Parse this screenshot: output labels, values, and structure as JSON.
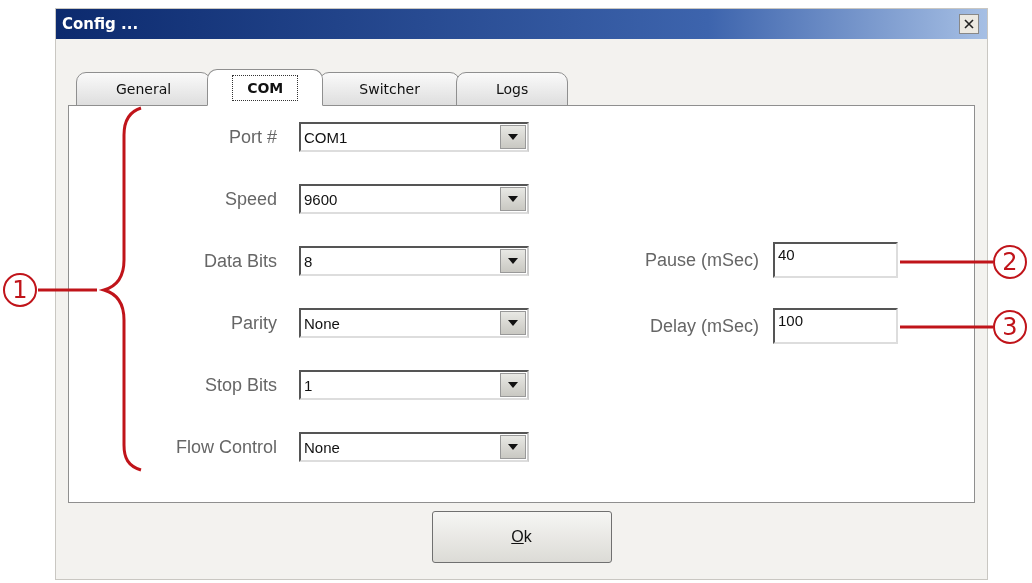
{
  "window": {
    "title": "Config ..."
  },
  "tabs": [
    {
      "label": "General",
      "selected": false
    },
    {
      "label": "COM",
      "selected": true
    },
    {
      "label": "Switcher",
      "selected": false
    },
    {
      "label": "Logs",
      "selected": false
    }
  ],
  "com_settings": [
    {
      "label": "Port #",
      "value": "COM1"
    },
    {
      "label": "Speed",
      "value": "9600"
    },
    {
      "label": "Data Bits",
      "value": "8"
    },
    {
      "label": "Parity",
      "value": "None"
    },
    {
      "label": "Stop Bits",
      "value": "1"
    },
    {
      "label": "Flow Control",
      "value": "None"
    }
  ],
  "timing_fields": [
    {
      "label": "Pause (mSec)",
      "value": "40"
    },
    {
      "label": "Delay (mSec)",
      "value": "100"
    }
  ],
  "buttons": [
    {
      "label": "Ok",
      "mnemonic_underlined": true
    }
  ],
  "annotations": [
    {
      "number": "1",
      "kind": "brace"
    },
    {
      "number": "2",
      "kind": "line"
    },
    {
      "number": "3",
      "kind": "line"
    }
  ]
}
